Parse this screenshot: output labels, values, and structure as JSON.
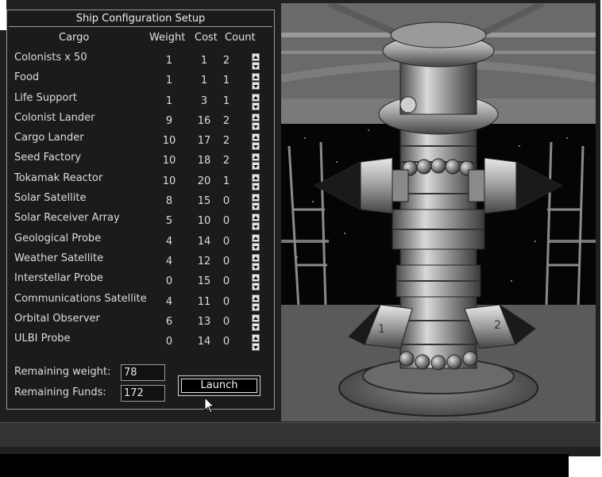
{
  "dialog": {
    "title": "Ship Configuration Setup",
    "headers": {
      "cargo": "Cargo",
      "weight": "Weight",
      "cost": "Cost",
      "count": "Count"
    },
    "items": [
      {
        "name": "Colonists x 50",
        "weight": "1",
        "cost": "1",
        "count": "2"
      },
      {
        "name": "Food",
        "weight": "1",
        "cost": "1",
        "count": "1"
      },
      {
        "name": "Life Support",
        "weight": "1",
        "cost": "3",
        "count": "1"
      },
      {
        "name": "Colonist Lander",
        "weight": "9",
        "cost": "16",
        "count": "2"
      },
      {
        "name": "Cargo Lander",
        "weight": "10",
        "cost": "17",
        "count": "2"
      },
      {
        "name": "Seed Factory",
        "weight": "10",
        "cost": "18",
        "count": "2"
      },
      {
        "name": "Tokamak Reactor",
        "weight": "10",
        "cost": "20",
        "count": "1"
      },
      {
        "name": "Solar Satellite",
        "weight": "8",
        "cost": "15",
        "count": "0"
      },
      {
        "name": "Solar Receiver Array",
        "weight": "5",
        "cost": "10",
        "count": "0"
      },
      {
        "name": "Geological Probe",
        "weight": "4",
        "cost": "14",
        "count": "0"
      },
      {
        "name": "Weather Satellite",
        "weight": "4",
        "cost": "12",
        "count": "0"
      },
      {
        "name": "Interstellar Probe",
        "weight": "0",
        "cost": "15",
        "count": "0"
      },
      {
        "name": "Communications Satellite",
        "weight": "4",
        "cost": "11",
        "count": "0"
      },
      {
        "name": "Orbital Observer",
        "weight": "6",
        "cost": "13",
        "count": "0"
      },
      {
        "name": "ULBI Probe",
        "weight": "0",
        "cost": "14",
        "count": "0"
      }
    ],
    "remaining_weight_label": "Remaining weight:",
    "remaining_weight": "78",
    "remaining_funds_label": "Remaining Funds:",
    "remaining_funds": "172",
    "launch_label": "Launch"
  },
  "scene": {
    "pod_left_number": "1",
    "pod_right_number": "2"
  }
}
